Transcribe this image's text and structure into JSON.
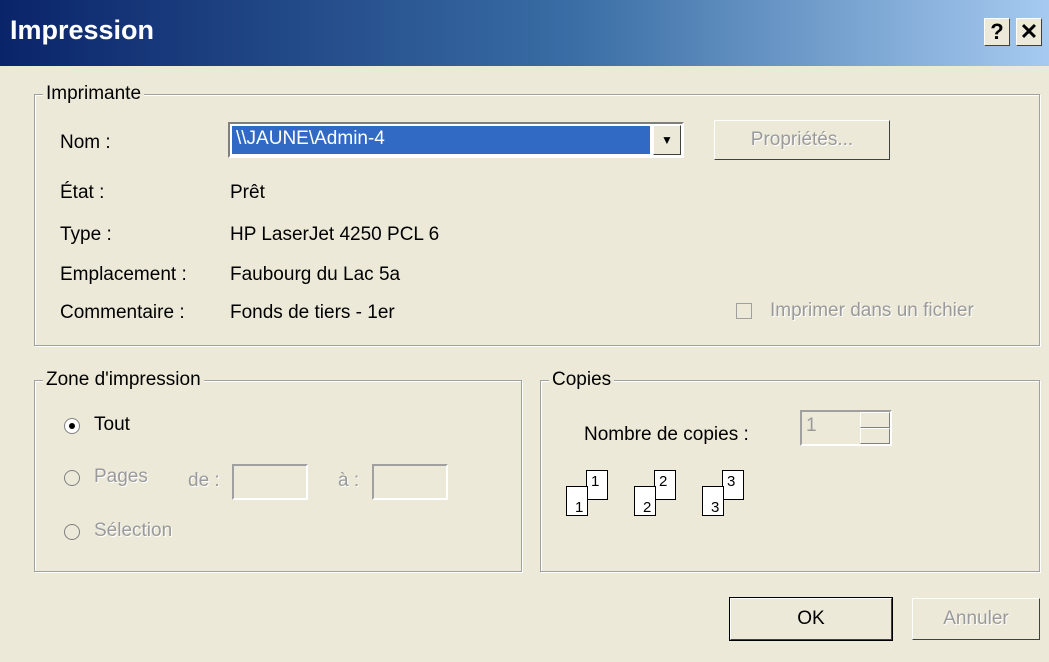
{
  "window": {
    "title": "Impression",
    "help_glyph": "?",
    "close_glyph": "✕"
  },
  "printer": {
    "group_label": "Imprimante",
    "name_label": "Nom :",
    "name_value": "\\\\JAUNE\\Admin-4",
    "properties_label": "Propriétés...",
    "state_label": "État :",
    "state_value": "Prêt",
    "type_label": "Type :",
    "type_value": "HP LaserJet 4250 PCL 6",
    "location_label": "Emplacement :",
    "location_value": "Faubourg du Lac 5a",
    "comment_label": "Commentaire :",
    "comment_value": "Fonds de tiers - 1er",
    "print_to_file_label": "Imprimer dans un fichier"
  },
  "print_range": {
    "group_label": "Zone d'impression",
    "all_label": "Tout",
    "pages_label": "Pages",
    "from_label": "de :",
    "to_label": "à :",
    "selection_label": "Sélection"
  },
  "copies": {
    "group_label": "Copies",
    "count_label": "Nombre de copies :",
    "count_value": "1",
    "collate_pages": [
      "1",
      "1",
      "2",
      "2",
      "3",
      "3"
    ]
  },
  "buttons": {
    "ok": "OK",
    "cancel": "Annuler"
  }
}
